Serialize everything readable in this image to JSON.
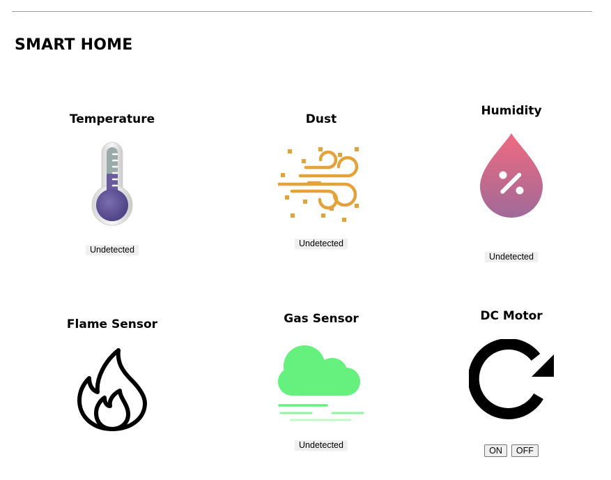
{
  "page": {
    "title": "SMART HOME"
  },
  "sensors": {
    "temperature": {
      "title": "Temperature",
      "status": "Undetected",
      "icon": "thermometer-icon"
    },
    "dust": {
      "title": "Dust",
      "status": "Undetected",
      "icon": "wind-dust-icon"
    },
    "humidity": {
      "title": "Humidity",
      "status": "Undetected",
      "icon": "humidity-drop-icon"
    },
    "flame": {
      "title": "Flame Sensor",
      "icon": "flame-icon"
    },
    "gas": {
      "title": "Gas Sensor",
      "status": "Undetected",
      "icon": "gas-cloud-icon"
    },
    "motor": {
      "title": "DC Motor",
      "on_label": "ON",
      "off_label": "OFF",
      "icon": "rotate-icon"
    }
  },
  "colors": {
    "thermo_fill": "#6a5a9e",
    "dust": "#e3a33a",
    "drop_top": "#ee6c80",
    "drop_bottom": "#9a6a98",
    "gas_cloud": "#6cf082",
    "status_bg": "#efefef",
    "rule": "#9a9a9a"
  }
}
